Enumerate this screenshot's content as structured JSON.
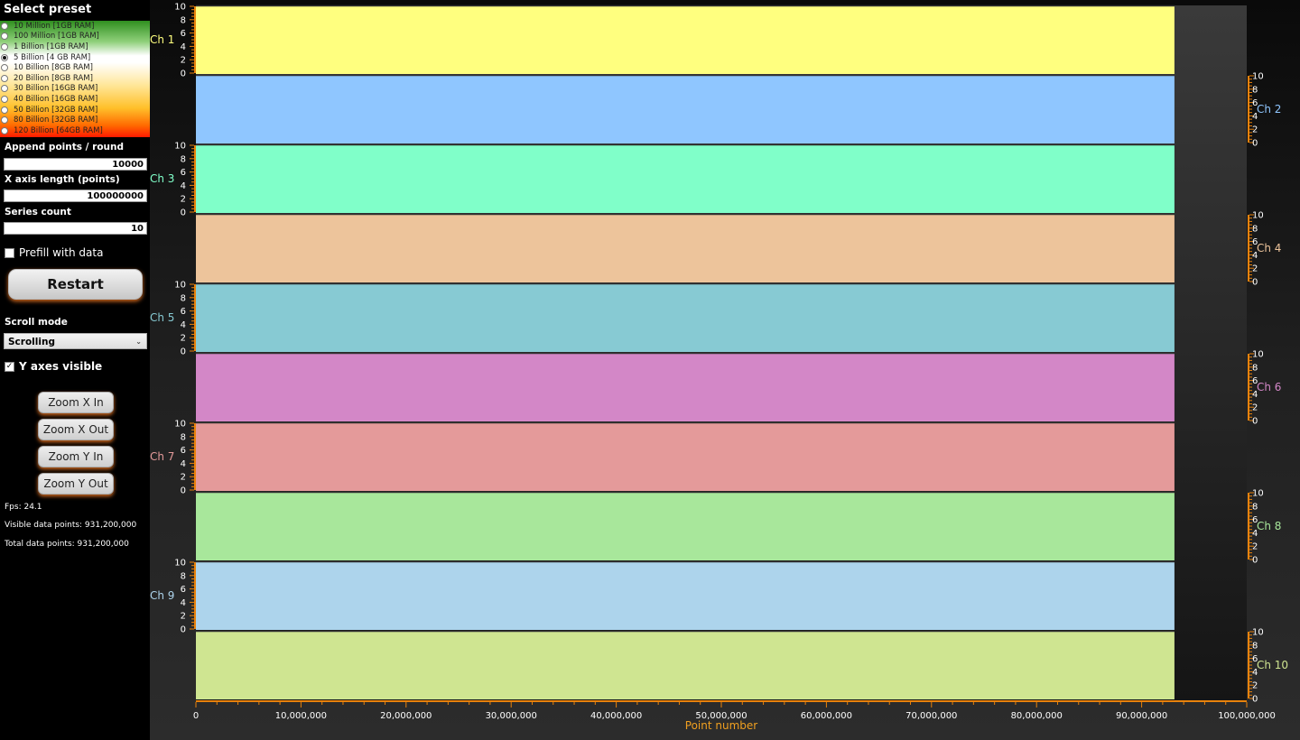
{
  "sidebar": {
    "title": "Select preset",
    "presets": [
      {
        "label": "10 Million [1GB RAM]",
        "selected": false
      },
      {
        "label": "100 Million [1GB RAM]",
        "selected": false
      },
      {
        "label": "1 Billion [1GB RAM]",
        "selected": false
      },
      {
        "label": "5 Billion [4 GB RAM]",
        "selected": true
      },
      {
        "label": "10 Billion [8GB RAM]",
        "selected": false
      },
      {
        "label": "20 Billion [8GB RAM]",
        "selected": false
      },
      {
        "label": "30 Billion [16GB RAM]",
        "selected": false
      },
      {
        "label": "40 Billion [16GB RAM]",
        "selected": false
      },
      {
        "label": "50 Billion [32GB RAM]",
        "selected": false
      },
      {
        "label": "80 Billion [32GB RAM]",
        "selected": false
      },
      {
        "label": "120 Billion [64GB RAM]",
        "selected": false
      }
    ],
    "append_label": "Append points / round",
    "append_value": "10000",
    "xlen_label": "X axis length (points)",
    "xlen_value": "100000000",
    "series_label": "Series count",
    "series_value": "10",
    "prefill_label": "Prefill with data",
    "prefill_checked": false,
    "restart_label": "Restart",
    "scroll_mode_label": "Scroll mode",
    "scroll_mode_value": "Scrolling",
    "y_axes_label": "Y axes visible",
    "y_axes_checked": true,
    "zoom_x_in": "Zoom X In",
    "zoom_x_out": "Zoom X Out",
    "zoom_y_in": "Zoom Y In",
    "zoom_y_out": "Zoom Y Out",
    "fps": "Fps: 24.1",
    "visible_points": "Visible data points: 931,200,000",
    "total_points": "Total data points: 931,200,000"
  },
  "colors": {
    "axis_orange": "#e8820c",
    "xlabel_orange": "#f0a020"
  },
  "chart_data": {
    "type": "area",
    "xlabel": "Point number",
    "xlim": [
      0,
      100000000
    ],
    "x_ticks": [
      "0",
      "10,000,000",
      "20,000,000",
      "30,000,000",
      "40,000,000",
      "50,000,000",
      "60,000,000",
      "70,000,000",
      "80,000,000",
      "90,000,000",
      "100,000,000"
    ],
    "data_end_x": 93120000,
    "ylim": [
      0,
      10
    ],
    "y_ticks": [
      "0",
      "2",
      "4",
      "6",
      "8",
      "10"
    ],
    "series": [
      {
        "name": "Ch 1",
        "color": "#ffff7f",
        "axis": "left"
      },
      {
        "name": "Ch 2",
        "color": "#8fc6ff",
        "axis": "right"
      },
      {
        "name": "Ch 3",
        "color": "#80ffc9",
        "axis": "left"
      },
      {
        "name": "Ch 4",
        "color": "#edc49b",
        "axis": "right"
      },
      {
        "name": "Ch 5",
        "color": "#87cad3",
        "axis": "left"
      },
      {
        "name": "Ch 6",
        "color": "#d387c7",
        "axis": "right"
      },
      {
        "name": "Ch 7",
        "color": "#e49a9a",
        "axis": "left"
      },
      {
        "name": "Ch 8",
        "color": "#a8e79b",
        "axis": "right"
      },
      {
        "name": "Ch 9",
        "color": "#add4ec",
        "axis": "left"
      },
      {
        "name": "Ch 10",
        "color": "#cfe591",
        "axis": "right"
      }
    ]
  }
}
